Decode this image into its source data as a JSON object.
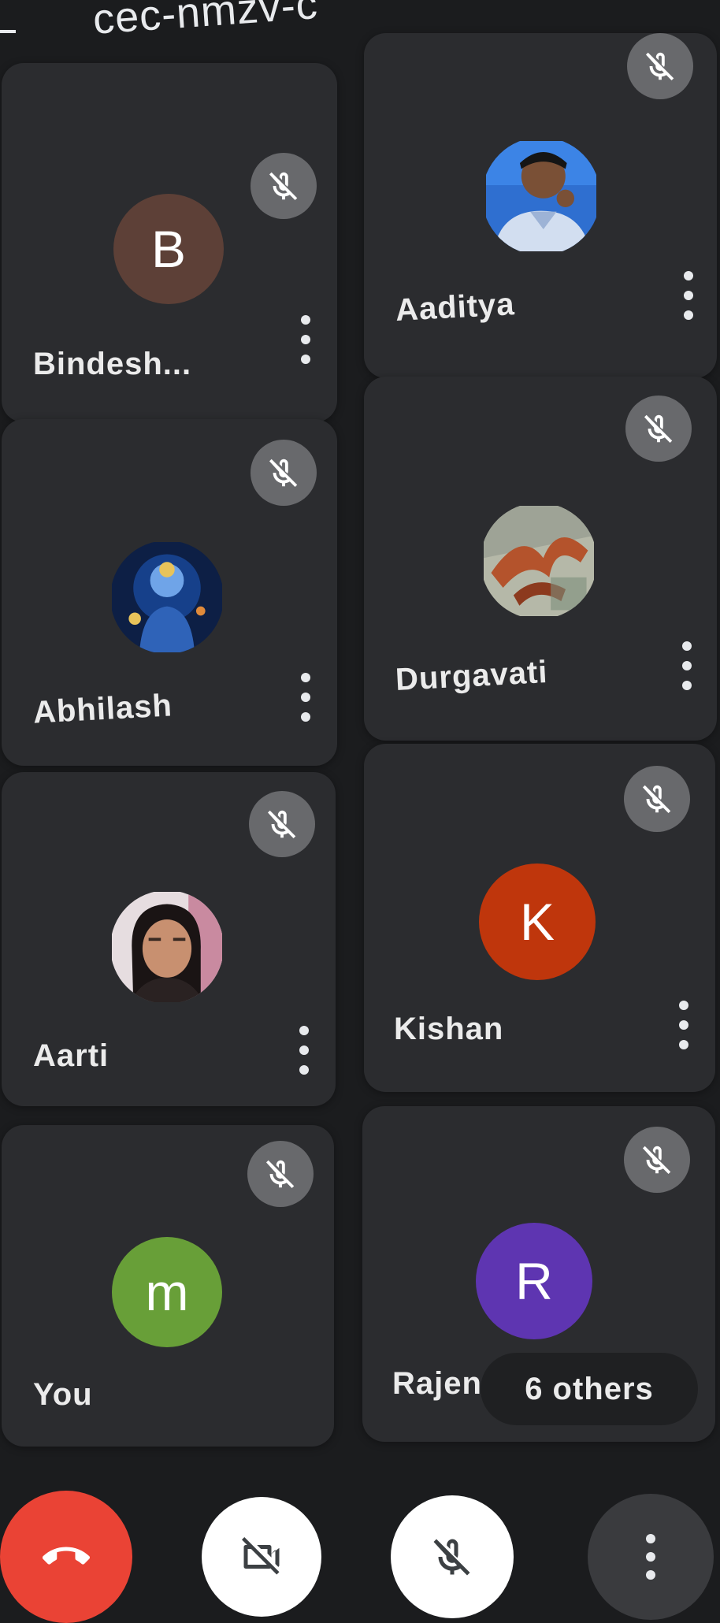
{
  "header": {
    "meeting_code": "cec-nmzv-c"
  },
  "participants": [
    {
      "name": "Bindesh...",
      "avatar_letter": "B",
      "avatar_color": "#5d4037",
      "muted": true
    },
    {
      "name": "Aaditya",
      "avatar_type": "photo",
      "muted": true
    },
    {
      "name": "Abhilash",
      "avatar_type": "photo",
      "muted": true
    },
    {
      "name": "Durgavati",
      "avatar_type": "photo",
      "muted": true
    },
    {
      "name": "Aarti",
      "avatar_type": "photo",
      "muted": true
    },
    {
      "name": "Kishan",
      "avatar_letter": "K",
      "avatar_color": "#bf360c",
      "muted": true
    },
    {
      "name": "You",
      "avatar_letter": "m",
      "avatar_color": "#689f38",
      "muted": true
    },
    {
      "name": "Rajen",
      "avatar_letter": "R",
      "avatar_color": "#5e35b1",
      "muted": true
    }
  ],
  "others_label": "6 others",
  "controls": {
    "end_call_color": "#ea4335",
    "camera_state": "off",
    "mic_state": "off"
  },
  "icons": {
    "back": "arrow-back-icon",
    "mute": "mic-off-icon",
    "more": "more-vert-icon",
    "end": "call-end-icon",
    "camera": "videocam-off-icon",
    "mic": "mic-off-icon"
  }
}
